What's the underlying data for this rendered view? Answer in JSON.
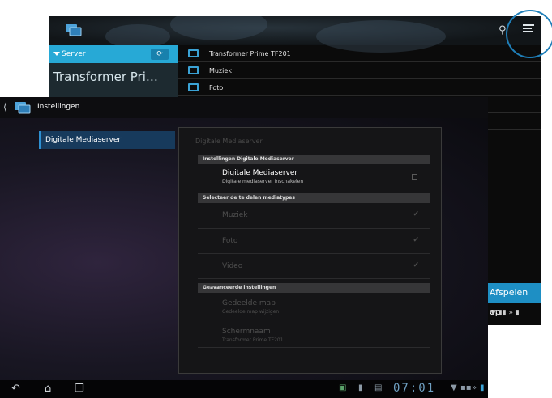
{
  "background_screen": {
    "server_label": "Server",
    "device_name": "Transformer Pri…",
    "rows": [
      {
        "label": "Transformer Prime TF201",
        "icon": "device-icon"
      },
      {
        "label": "Muziek",
        "icon": "folder-icon"
      },
      {
        "label": "Foto",
        "icon": "folder-icon"
      }
    ],
    "play_button": "Afspelen op"
  },
  "settings": {
    "window_title": "Instellingen",
    "nav_item": "Digitale Mediaserver",
    "panel_title": "Digitale Mediaserver",
    "section_1": "Instellingen Digitale Mediaserver",
    "enable_title": "Digitale Mediaserver",
    "enable_subtitle": "Digitale mediaserver inschakelen",
    "section_2": "Selecteer de te delen mediatypes",
    "media_types": [
      "Muziek",
      "Foto",
      "Video"
    ],
    "section_3": "Geavanceerde instellingen",
    "shared_folder_title": "Gedeelde map",
    "shared_folder_subtitle": "Gedeelde map wijzigen",
    "screen_name_title": "Schermnaam",
    "screen_name_subtitle": "Transformer Prime TF201"
  },
  "statusbar": {
    "time": "07:01"
  },
  "colors": {
    "accent": "#27a9d6",
    "highlight_ring": "#1f7fb9",
    "nav_selected": "#173a5c"
  }
}
